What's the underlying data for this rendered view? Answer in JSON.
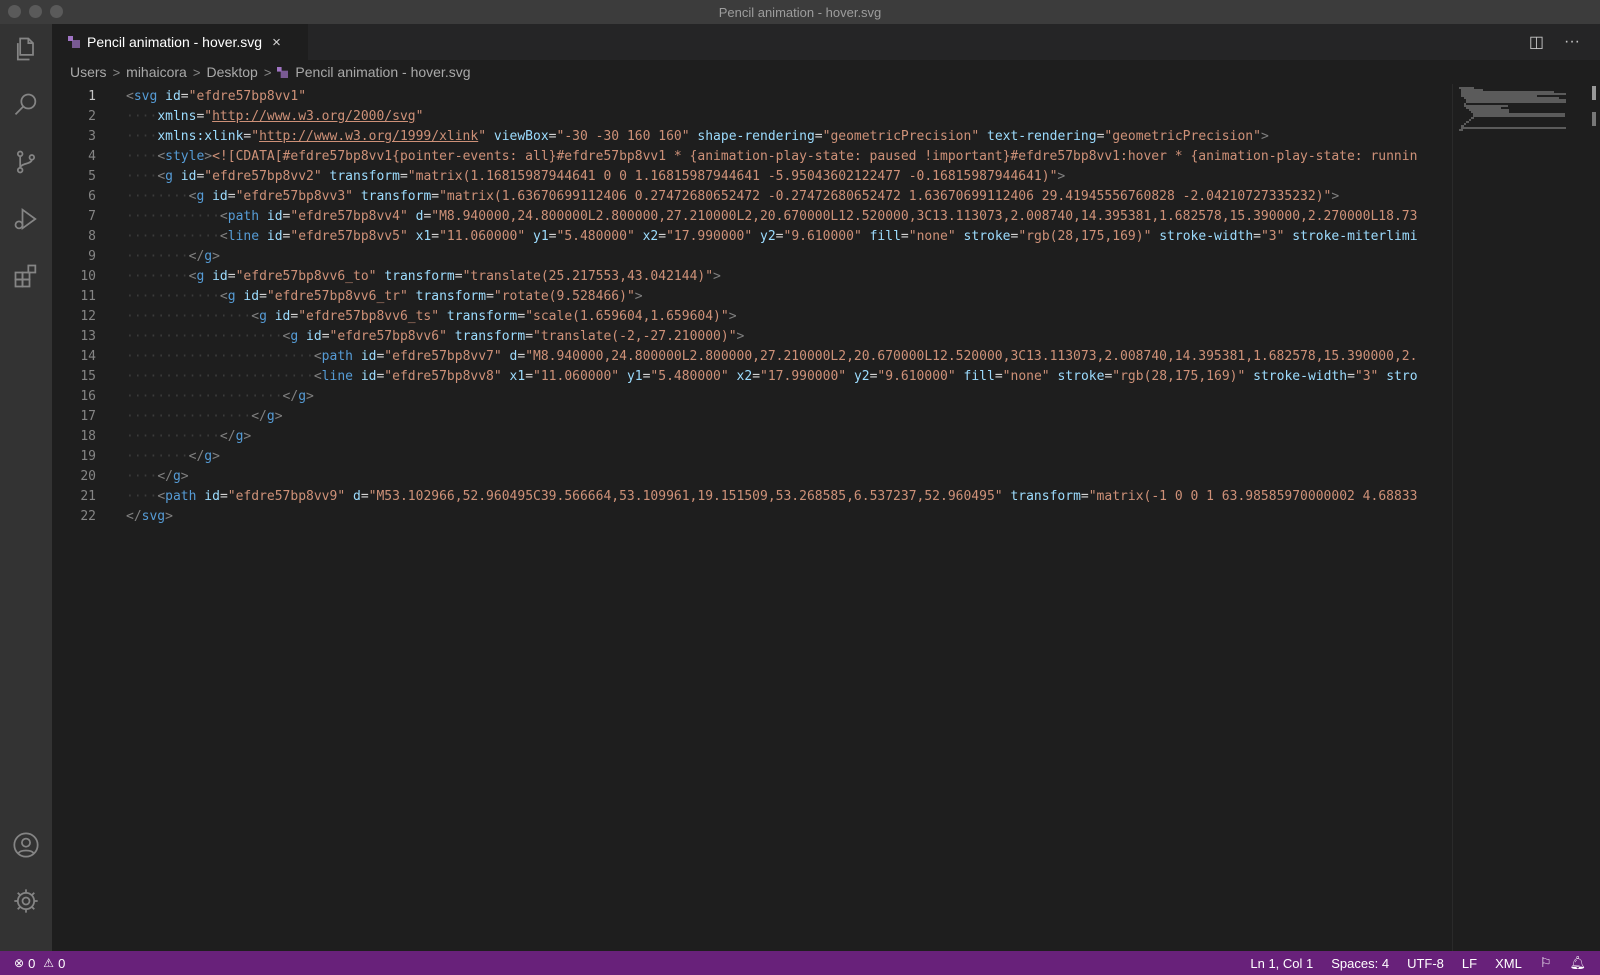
{
  "window": {
    "title": "Pencil animation - hover.svg"
  },
  "tab": {
    "label": "Pencil animation - hover.svg",
    "close": "×"
  },
  "tab_actions": {
    "split": "◫",
    "more": "···"
  },
  "breadcrumb": {
    "items": [
      "Users",
      "mihaicora",
      "Desktop",
      "Pencil animation - hover.svg"
    ],
    "separator": ">"
  },
  "editor": {
    "active_line": 1,
    "line_numbers": [
      "1",
      "2",
      "3",
      "4",
      "5",
      "6",
      "7",
      "8",
      "9",
      "10",
      "11",
      "12",
      "13",
      "14",
      "15",
      "16",
      "17",
      "18",
      "19",
      "20",
      "21",
      "22"
    ],
    "lines": [
      [
        [
          "pun",
          "<"
        ],
        [
          "tag",
          "svg"
        ],
        [
          "txt",
          " "
        ],
        [
          "attr",
          "id"
        ],
        [
          "txt",
          "="
        ],
        [
          "str",
          "\"efdre57bp8vv1\""
        ]
      ],
      [
        [
          "ind",
          "····"
        ],
        [
          "attr",
          "xmlns"
        ],
        [
          "txt",
          "="
        ],
        [
          "str",
          "\""
        ],
        [
          "url",
          "http://www.w3.org/2000/svg"
        ],
        [
          "str",
          "\""
        ]
      ],
      [
        [
          "ind",
          "····"
        ],
        [
          "attr",
          "xmlns:xlink"
        ],
        [
          "txt",
          "="
        ],
        [
          "str",
          "\""
        ],
        [
          "url",
          "http://www.w3.org/1999/xlink"
        ],
        [
          "str",
          "\""
        ],
        [
          "txt",
          " "
        ],
        [
          "attr",
          "viewBox"
        ],
        [
          "txt",
          "="
        ],
        [
          "str",
          "\"-30 -30 160 160\""
        ],
        [
          "txt",
          " "
        ],
        [
          "attr",
          "shape-rendering"
        ],
        [
          "txt",
          "="
        ],
        [
          "str",
          "\"geometricPrecision\""
        ],
        [
          "txt",
          " "
        ],
        [
          "attr",
          "text-rendering"
        ],
        [
          "txt",
          "="
        ],
        [
          "str",
          "\"geometricPrecision\""
        ],
        [
          "pun",
          ">"
        ]
      ],
      [
        [
          "ind",
          "····"
        ],
        [
          "pun",
          "<"
        ],
        [
          "tag",
          "style"
        ],
        [
          "pun",
          ">"
        ],
        [
          "str",
          "<![CDATA[#efdre57bp8vv1{pointer-events: all}#efdre57bp8vv1 * {animation-play-state: paused !important}#efdre57bp8vv1:hover * {animation-play-state: runnin"
        ]
      ],
      [
        [
          "ind",
          "····"
        ],
        [
          "pun",
          "<"
        ],
        [
          "tag",
          "g"
        ],
        [
          "txt",
          " "
        ],
        [
          "attr",
          "id"
        ],
        [
          "txt",
          "="
        ],
        [
          "str",
          "\"efdre57bp8vv2\""
        ],
        [
          "txt",
          " "
        ],
        [
          "attr",
          "transform"
        ],
        [
          "txt",
          "="
        ],
        [
          "str",
          "\"matrix(1.16815987944641 0 0 1.16815987944641 -5.95043602122477 -0.16815987944641)\""
        ],
        [
          "pun",
          ">"
        ]
      ],
      [
        [
          "ind",
          "········"
        ],
        [
          "pun",
          "<"
        ],
        [
          "tag",
          "g"
        ],
        [
          "txt",
          " "
        ],
        [
          "attr",
          "id"
        ],
        [
          "txt",
          "="
        ],
        [
          "str",
          "\"efdre57bp8vv3\""
        ],
        [
          "txt",
          " "
        ],
        [
          "attr",
          "transform"
        ],
        [
          "txt",
          "="
        ],
        [
          "str",
          "\"matrix(1.63670699112406 0.27472680652472 -0.27472680652472 1.63670699112406 29.41945556760828 -2.04210727335232)\""
        ],
        [
          "pun",
          ">"
        ]
      ],
      [
        [
          "ind",
          "············"
        ],
        [
          "pun",
          "<"
        ],
        [
          "tag",
          "path"
        ],
        [
          "txt",
          " "
        ],
        [
          "attr",
          "id"
        ],
        [
          "txt",
          "="
        ],
        [
          "str",
          "\"efdre57bp8vv4\""
        ],
        [
          "txt",
          " "
        ],
        [
          "attr",
          "d"
        ],
        [
          "txt",
          "="
        ],
        [
          "str",
          "\"M8.940000,24.800000L2.800000,27.210000L2,20.670000L12.520000,3C13.113073,2.008740,14.395381,1.682578,15.390000,2.270000L18.73"
        ]
      ],
      [
        [
          "ind",
          "············"
        ],
        [
          "pun",
          "<"
        ],
        [
          "tag",
          "line"
        ],
        [
          "txt",
          " "
        ],
        [
          "attr",
          "id"
        ],
        [
          "txt",
          "="
        ],
        [
          "str",
          "\"efdre57bp8vv5\""
        ],
        [
          "txt",
          " "
        ],
        [
          "attr",
          "x1"
        ],
        [
          "txt",
          "="
        ],
        [
          "str",
          "\"11.060000\""
        ],
        [
          "txt",
          " "
        ],
        [
          "attr",
          "y1"
        ],
        [
          "txt",
          "="
        ],
        [
          "str",
          "\"5.480000\""
        ],
        [
          "txt",
          " "
        ],
        [
          "attr",
          "x2"
        ],
        [
          "txt",
          "="
        ],
        [
          "str",
          "\"17.990000\""
        ],
        [
          "txt",
          " "
        ],
        [
          "attr",
          "y2"
        ],
        [
          "txt",
          "="
        ],
        [
          "str",
          "\"9.610000\""
        ],
        [
          "txt",
          " "
        ],
        [
          "attr",
          "fill"
        ],
        [
          "txt",
          "="
        ],
        [
          "str",
          "\"none\""
        ],
        [
          "txt",
          " "
        ],
        [
          "attr",
          "stroke"
        ],
        [
          "txt",
          "="
        ],
        [
          "str",
          "\"rgb(28,175,169)\""
        ],
        [
          "txt",
          " "
        ],
        [
          "attr",
          "stroke-width"
        ],
        [
          "txt",
          "="
        ],
        [
          "str",
          "\"3\""
        ],
        [
          "txt",
          " "
        ],
        [
          "attr",
          "stroke-miterlimi"
        ]
      ],
      [
        [
          "ind",
          "········"
        ],
        [
          "pun",
          "</"
        ],
        [
          "tag",
          "g"
        ],
        [
          "pun",
          ">"
        ]
      ],
      [
        [
          "ind",
          "········"
        ],
        [
          "pun",
          "<"
        ],
        [
          "tag",
          "g"
        ],
        [
          "txt",
          " "
        ],
        [
          "attr",
          "id"
        ],
        [
          "txt",
          "="
        ],
        [
          "str",
          "\"efdre57bp8vv6_to\""
        ],
        [
          "txt",
          " "
        ],
        [
          "attr",
          "transform"
        ],
        [
          "txt",
          "="
        ],
        [
          "str",
          "\"translate(25.217553,43.042144)\""
        ],
        [
          "pun",
          ">"
        ]
      ],
      [
        [
          "ind",
          "············"
        ],
        [
          "pun",
          "<"
        ],
        [
          "tag",
          "g"
        ],
        [
          "txt",
          " "
        ],
        [
          "attr",
          "id"
        ],
        [
          "txt",
          "="
        ],
        [
          "str",
          "\"efdre57bp8vv6_tr\""
        ],
        [
          "txt",
          " "
        ],
        [
          "attr",
          "transform"
        ],
        [
          "txt",
          "="
        ],
        [
          "str",
          "\"rotate(9.528466)\""
        ],
        [
          "pun",
          ">"
        ]
      ],
      [
        [
          "ind",
          "················"
        ],
        [
          "pun",
          "<"
        ],
        [
          "tag",
          "g"
        ],
        [
          "txt",
          " "
        ],
        [
          "attr",
          "id"
        ],
        [
          "txt",
          "="
        ],
        [
          "str",
          "\"efdre57bp8vv6_ts\""
        ],
        [
          "txt",
          " "
        ],
        [
          "attr",
          "transform"
        ],
        [
          "txt",
          "="
        ],
        [
          "str",
          "\"scale(1.659604,1.659604)\""
        ],
        [
          "pun",
          ">"
        ]
      ],
      [
        [
          "ind",
          "····················"
        ],
        [
          "pun",
          "<"
        ],
        [
          "tag",
          "g"
        ],
        [
          "txt",
          " "
        ],
        [
          "attr",
          "id"
        ],
        [
          "txt",
          "="
        ],
        [
          "str",
          "\"efdre57bp8vv6\""
        ],
        [
          "txt",
          " "
        ],
        [
          "attr",
          "transform"
        ],
        [
          "txt",
          "="
        ],
        [
          "str",
          "\"translate(-2,-27.210000)\""
        ],
        [
          "pun",
          ">"
        ]
      ],
      [
        [
          "ind",
          "························"
        ],
        [
          "pun",
          "<"
        ],
        [
          "tag",
          "path"
        ],
        [
          "txt",
          " "
        ],
        [
          "attr",
          "id"
        ],
        [
          "txt",
          "="
        ],
        [
          "str",
          "\"efdre57bp8vv7\""
        ],
        [
          "txt",
          " "
        ],
        [
          "attr",
          "d"
        ],
        [
          "txt",
          "="
        ],
        [
          "str",
          "\"M8.940000,24.800000L2.800000,27.210000L2,20.670000L12.520000,3C13.113073,2.008740,14.395381,1.682578,15.390000,2."
        ]
      ],
      [
        [
          "ind",
          "························"
        ],
        [
          "pun",
          "<"
        ],
        [
          "tag",
          "line"
        ],
        [
          "txt",
          " "
        ],
        [
          "attr",
          "id"
        ],
        [
          "txt",
          "="
        ],
        [
          "str",
          "\"efdre57bp8vv8\""
        ],
        [
          "txt",
          " "
        ],
        [
          "attr",
          "x1"
        ],
        [
          "txt",
          "="
        ],
        [
          "str",
          "\"11.060000\""
        ],
        [
          "txt",
          " "
        ],
        [
          "attr",
          "y1"
        ],
        [
          "txt",
          "="
        ],
        [
          "str",
          "\"5.480000\""
        ],
        [
          "txt",
          " "
        ],
        [
          "attr",
          "x2"
        ],
        [
          "txt",
          "="
        ],
        [
          "str",
          "\"17.990000\""
        ],
        [
          "txt",
          " "
        ],
        [
          "attr",
          "y2"
        ],
        [
          "txt",
          "="
        ],
        [
          "str",
          "\"9.610000\""
        ],
        [
          "txt",
          " "
        ],
        [
          "attr",
          "fill"
        ],
        [
          "txt",
          "="
        ],
        [
          "str",
          "\"none\""
        ],
        [
          "txt",
          " "
        ],
        [
          "attr",
          "stroke"
        ],
        [
          "txt",
          "="
        ],
        [
          "str",
          "\"rgb(28,175,169)\""
        ],
        [
          "txt",
          " "
        ],
        [
          "attr",
          "stroke-width"
        ],
        [
          "txt",
          "="
        ],
        [
          "str",
          "\"3\""
        ],
        [
          "txt",
          " "
        ],
        [
          "attr",
          "stro"
        ]
      ],
      [
        [
          "ind",
          "····················"
        ],
        [
          "pun",
          "</"
        ],
        [
          "tag",
          "g"
        ],
        [
          "pun",
          ">"
        ]
      ],
      [
        [
          "ind",
          "················"
        ],
        [
          "pun",
          "</"
        ],
        [
          "tag",
          "g"
        ],
        [
          "pun",
          ">"
        ]
      ],
      [
        [
          "ind",
          "············"
        ],
        [
          "pun",
          "</"
        ],
        [
          "tag",
          "g"
        ],
        [
          "pun",
          ">"
        ]
      ],
      [
        [
          "ind",
          "········"
        ],
        [
          "pun",
          "</"
        ],
        [
          "tag",
          "g"
        ],
        [
          "pun",
          ">"
        ]
      ],
      [
        [
          "ind",
          "····"
        ],
        [
          "pun",
          "</"
        ],
        [
          "tag",
          "g"
        ],
        [
          "pun",
          ">"
        ]
      ],
      [
        [
          "ind",
          "····"
        ],
        [
          "pun",
          "<"
        ],
        [
          "tag",
          "path"
        ],
        [
          "txt",
          " "
        ],
        [
          "attr",
          "id"
        ],
        [
          "txt",
          "="
        ],
        [
          "str",
          "\"efdre57bp8vv9\""
        ],
        [
          "txt",
          " "
        ],
        [
          "attr",
          "d"
        ],
        [
          "txt",
          "="
        ],
        [
          "str",
          "\"M53.102966,52.960495C39.566664,53.109961,19.151509,53.268585,6.537237,52.960495\""
        ],
        [
          "txt",
          " "
        ],
        [
          "attr",
          "transform"
        ],
        [
          "txt",
          "="
        ],
        [
          "str",
          "\"matrix(-1 0 0 1 63.98585970000002 4.68833"
        ]
      ],
      [
        [
          "pun",
          "</"
        ],
        [
          "tag",
          "svg"
        ],
        [
          "pun",
          ">"
        ]
      ]
    ]
  },
  "status": {
    "errors": "0",
    "warnings": "0",
    "cursor": "Ln 1, Col 1",
    "spaces": "Spaces: 4",
    "encoding": "UTF-8",
    "eol": "LF",
    "language": "XML"
  },
  "colors": {
    "accent": "#68217a",
    "tag": "#569cd6",
    "attribute": "#9cdcfe",
    "string": "#ce9178",
    "editor_bg": "#1e1e1e"
  },
  "icons": {
    "activity": [
      "files-icon",
      "search-icon",
      "source-control-icon",
      "run-debug-icon",
      "extensions-icon",
      "account-icon",
      "settings-gear-icon"
    ]
  }
}
